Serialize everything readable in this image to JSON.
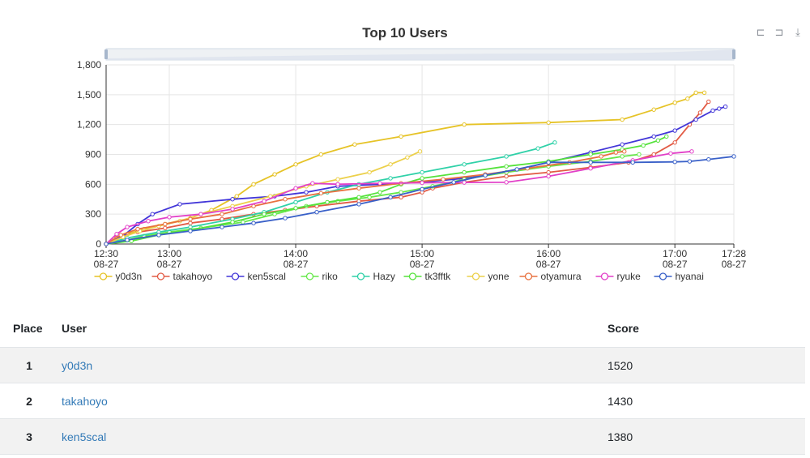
{
  "chart_data": {
    "type": "line",
    "title": "Top 10 Users",
    "ylim": [
      0,
      1800
    ],
    "yticks": [
      "0",
      "300",
      "600",
      "900",
      "1,200",
      "1,500",
      "1,800"
    ],
    "ytick_values": [
      0,
      300,
      600,
      900,
      1200,
      1500,
      1800
    ],
    "xticks": [
      {
        "t": 750,
        "time": "12:30",
        "date": "08-27"
      },
      {
        "t": 780,
        "time": "13:00",
        "date": "08-27"
      },
      {
        "t": 840,
        "time": "14:00",
        "date": "08-27"
      },
      {
        "t": 900,
        "time": "15:00",
        "date": "08-27"
      },
      {
        "t": 960,
        "time": "16:00",
        "date": "08-27"
      },
      {
        "t": 1020,
        "time": "17:00",
        "date": "08-27"
      },
      {
        "t": 1048,
        "time": "17:28",
        "date": "08-27"
      }
    ],
    "x_unit": "minutes of day (08-27)",
    "xlim": [
      750,
      1048
    ],
    "grid": true,
    "legend_position": "bottom",
    "series": [
      {
        "name": "y0d3n",
        "color": "#e6c327",
        "points": [
          [
            750,
            0
          ],
          [
            754,
            50
          ],
          [
            760,
            100
          ],
          [
            768,
            150
          ],
          [
            778,
            200
          ],
          [
            790,
            260
          ],
          [
            800,
            340
          ],
          [
            812,
            480
          ],
          [
            820,
            600
          ],
          [
            830,
            700
          ],
          [
            840,
            800
          ],
          [
            852,
            900
          ],
          [
            868,
            1000
          ],
          [
            890,
            1080
          ],
          [
            920,
            1200
          ],
          [
            960,
            1220
          ],
          [
            995,
            1250
          ],
          [
            1010,
            1350
          ],
          [
            1020,
            1420
          ],
          [
            1026,
            1460
          ],
          [
            1030,
            1520
          ],
          [
            1034,
            1520
          ]
        ]
      },
      {
        "name": "takahoyo",
        "color": "#e25a44",
        "points": [
          [
            750,
            0
          ],
          [
            755,
            60
          ],
          [
            765,
            120
          ],
          [
            778,
            160
          ],
          [
            790,
            210
          ],
          [
            805,
            250
          ],
          [
            820,
            300
          ],
          [
            835,
            340
          ],
          [
            850,
            380
          ],
          [
            870,
            430
          ],
          [
            890,
            470
          ],
          [
            900,
            520
          ],
          [
            905,
            560
          ],
          [
            920,
            620
          ],
          [
            940,
            680
          ],
          [
            960,
            720
          ],
          [
            980,
            770
          ],
          [
            998,
            820
          ],
          [
            1010,
            900
          ],
          [
            1020,
            1020
          ],
          [
            1027,
            1200
          ],
          [
            1032,
            1320
          ],
          [
            1036,
            1430
          ]
        ]
      },
      {
        "name": "ken5scal",
        "color": "#4236d8",
        "points": [
          [
            750,
            0
          ],
          [
            758,
            80
          ],
          [
            765,
            200
          ],
          [
            772,
            300
          ],
          [
            785,
            400
          ],
          [
            810,
            450
          ],
          [
            830,
            480
          ],
          [
            845,
            520
          ],
          [
            860,
            580
          ],
          [
            880,
            600
          ],
          [
            900,
            620
          ],
          [
            920,
            660
          ],
          [
            940,
            720
          ],
          [
            960,
            820
          ],
          [
            980,
            920
          ],
          [
            995,
            1000
          ],
          [
            1010,
            1080
          ],
          [
            1020,
            1140
          ],
          [
            1030,
            1250
          ],
          [
            1038,
            1340
          ],
          [
            1041,
            1360
          ],
          [
            1044,
            1380
          ]
        ]
      },
      {
        "name": "riko",
        "color": "#66e84a",
        "points": [
          [
            750,
            0
          ],
          [
            760,
            40
          ],
          [
            768,
            80
          ],
          [
            780,
            120
          ],
          [
            795,
            160
          ],
          [
            815,
            220
          ],
          [
            830,
            300
          ],
          [
            845,
            380
          ],
          [
            860,
            430
          ],
          [
            875,
            470
          ],
          [
            890,
            520
          ],
          [
            905,
            580
          ],
          [
            920,
            650
          ],
          [
            940,
            720
          ],
          [
            960,
            780
          ],
          [
            980,
            830
          ],
          [
            995,
            880
          ],
          [
            1003,
            900
          ]
        ]
      },
      {
        "name": "Hazy",
        "color": "#2fd1a8",
        "points": [
          [
            750,
            0
          ],
          [
            760,
            60
          ],
          [
            775,
            120
          ],
          [
            790,
            170
          ],
          [
            810,
            250
          ],
          [
            825,
            320
          ],
          [
            840,
            420
          ],
          [
            855,
            520
          ],
          [
            870,
            600
          ],
          [
            885,
            660
          ],
          [
            900,
            720
          ],
          [
            920,
            800
          ],
          [
            940,
            880
          ],
          [
            955,
            960
          ],
          [
            963,
            1020
          ]
        ]
      },
      {
        "name": "tk3fftk",
        "color": "#55e23c",
        "points": [
          [
            750,
            0
          ],
          [
            762,
            30
          ],
          [
            775,
            90
          ],
          [
            790,
            140
          ],
          [
            810,
            220
          ],
          [
            825,
            300
          ],
          [
            840,
            360
          ],
          [
            855,
            420
          ],
          [
            870,
            470
          ],
          [
            880,
            520
          ],
          [
            890,
            600
          ],
          [
            900,
            660
          ],
          [
            920,
            720
          ],
          [
            940,
            780
          ],
          [
            960,
            830
          ],
          [
            980,
            900
          ],
          [
            995,
            950
          ],
          [
            1005,
            990
          ],
          [
            1012,
            1040
          ],
          [
            1016,
            1080
          ]
        ]
      },
      {
        "name": "yone",
        "color": "#ecd04a",
        "points": [
          [
            750,
            0
          ],
          [
            758,
            70
          ],
          [
            766,
            130
          ],
          [
            775,
            180
          ],
          [
            785,
            230
          ],
          [
            795,
            300
          ],
          [
            810,
            380
          ],
          [
            828,
            480
          ],
          [
            845,
            580
          ],
          [
            860,
            650
          ],
          [
            875,
            720
          ],
          [
            885,
            800
          ],
          [
            893,
            870
          ],
          [
            899,
            930
          ]
        ]
      },
      {
        "name": "otyamura",
        "color": "#e8713f",
        "points": [
          [
            750,
            0
          ],
          [
            757,
            90
          ],
          [
            765,
            150
          ],
          [
            778,
            200
          ],
          [
            790,
            250
          ],
          [
            805,
            300
          ],
          [
            820,
            380
          ],
          [
            835,
            450
          ],
          [
            852,
            510
          ],
          [
            870,
            560
          ],
          [
            890,
            610
          ],
          [
            910,
            650
          ],
          [
            930,
            700
          ],
          [
            950,
            760
          ],
          [
            970,
            820
          ],
          [
            985,
            880
          ],
          [
            992,
            920
          ],
          [
            996,
            930
          ]
        ]
      },
      {
        "name": "ryuke",
        "color": "#e23fc8",
        "points": [
          [
            750,
            0
          ],
          [
            755,
            100
          ],
          [
            760,
            170
          ],
          [
            770,
            230
          ],
          [
            780,
            270
          ],
          [
            795,
            300
          ],
          [
            810,
            350
          ],
          [
            825,
            430
          ],
          [
            840,
            560
          ],
          [
            848,
            610
          ],
          [
            860,
            600
          ],
          [
            880,
            610
          ],
          [
            900,
            615
          ],
          [
            920,
            618
          ],
          [
            940,
            620
          ],
          [
            960,
            680
          ],
          [
            980,
            760
          ],
          [
            1000,
            840
          ],
          [
            1018,
            910
          ],
          [
            1028,
            930
          ]
        ]
      },
      {
        "name": "hyanai",
        "color": "#3960c8",
        "points": [
          [
            750,
            0
          ],
          [
            760,
            40
          ],
          [
            775,
            90
          ],
          [
            790,
            130
          ],
          [
            805,
            170
          ],
          [
            820,
            210
          ],
          [
            835,
            260
          ],
          [
            850,
            320
          ],
          [
            870,
            400
          ],
          [
            885,
            470
          ],
          [
            900,
            550
          ],
          [
            915,
            620
          ],
          [
            930,
            690
          ],
          [
            945,
            750
          ],
          [
            960,
            820
          ],
          [
            980,
            820
          ],
          [
            1000,
            820
          ],
          [
            1020,
            825
          ],
          [
            1027,
            830
          ],
          [
            1036,
            850
          ],
          [
            1048,
            880
          ]
        ]
      }
    ]
  },
  "toolbox": {
    "zoom_icon": "zoom-icon",
    "zoom_reset_icon": "zoom-reset-icon",
    "download_icon": "download-icon"
  },
  "table": {
    "headers": {
      "place": "Place",
      "user": "User",
      "score": "Score"
    },
    "rows": [
      {
        "place": "1",
        "user": "y0d3n",
        "score": "1520"
      },
      {
        "place": "2",
        "user": "takahoyo",
        "score": "1430"
      },
      {
        "place": "3",
        "user": "ken5scal",
        "score": "1380"
      }
    ]
  },
  "colors": {
    "grid": "#e5e5e5",
    "axis": "#333333",
    "link": "#337ab7"
  }
}
